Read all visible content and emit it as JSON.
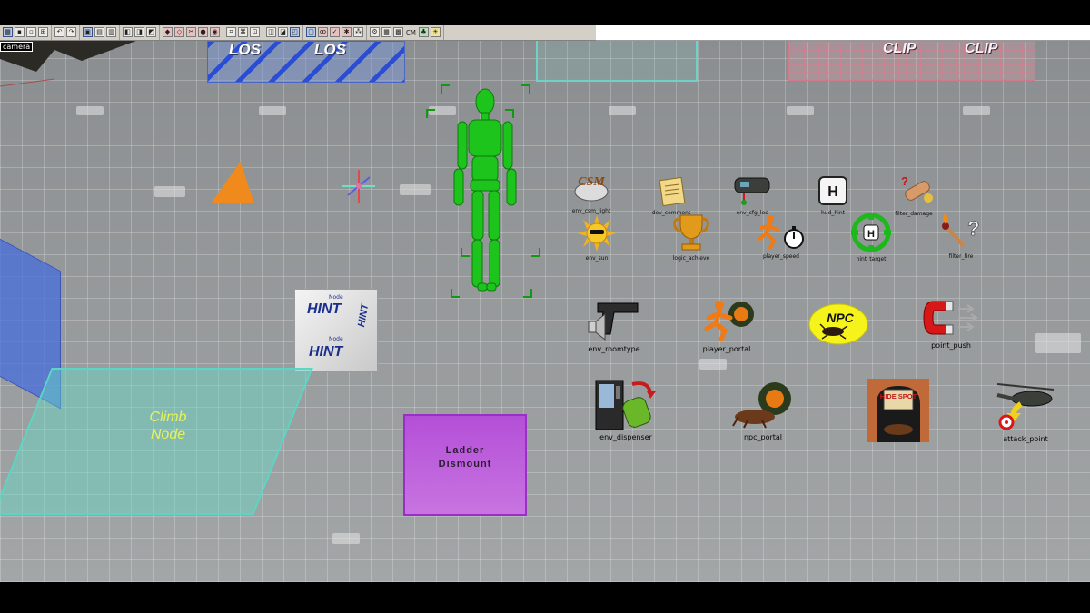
{
  "toolbar": {
    "label_cm": "CM"
  },
  "viewport": {
    "camera_label": "camera",
    "los_word_1": "LOS",
    "los_word_2": "LOS",
    "clip_word_1": "CLIP",
    "clip_word_2": "CLIP",
    "climb_node_label_1": "Climb",
    "climb_node_label_2": "Node",
    "ladder_label_1": "Ladder",
    "ladder_label_2": "Dismount",
    "hint_node_small_1": "Node",
    "hint_word_1": "HINT",
    "hint_node_small_2": "Node",
    "hint_word_2": "HINT",
    "hint_word_3": "HINT"
  },
  "entities": [
    {
      "label": "env_csm_light",
      "icon": "csm-icon",
      "text": "CSM"
    },
    {
      "label": "dev_comment",
      "icon": "note-icon"
    },
    {
      "label": "env_cfg_loc",
      "icon": "gun-loc-icon"
    },
    {
      "label": "hud_hint",
      "icon": "h-key-icon",
      "text": "H"
    },
    {
      "label": "filter_damage",
      "icon": "bandage-icon",
      "text": "?"
    },
    {
      "label": "env_sun",
      "icon": "sun-icon"
    },
    {
      "label": "logic_achieve",
      "icon": "trophy-icon"
    },
    {
      "label": "player_speed",
      "icon": "runner-stopwatch-icon"
    },
    {
      "label": "hint_target",
      "icon": "target-icon",
      "text": "H"
    },
    {
      "label": "filter_fire",
      "icon": "match-icon",
      "text": "?"
    },
    {
      "label": "env_roomtype",
      "icon": "pistol-speaker-icon"
    },
    {
      "label": "player_portal",
      "icon": "runner-portal-icon"
    },
    {
      "label": "",
      "icon": "npc-bug-icon",
      "text": "NPC"
    },
    {
      "label": "point_push",
      "icon": "magnet-icon"
    },
    {
      "label": "env_dispenser",
      "icon": "vending-machine-icon"
    },
    {
      "label": "npc_portal",
      "icon": "creature-portal-icon"
    },
    {
      "label": "",
      "icon": "hide-spot-icon",
      "text": "HIDE SPOT"
    },
    {
      "label": "attack_point",
      "icon": "helicopter-icon"
    }
  ],
  "colors": {
    "viewport_floor": "#8e9192",
    "los_stripe": "#1e46dc",
    "climb_volume": "#64dcc8",
    "ladder_volume": "#b44fd8",
    "figure_green": "#1cc41c"
  }
}
